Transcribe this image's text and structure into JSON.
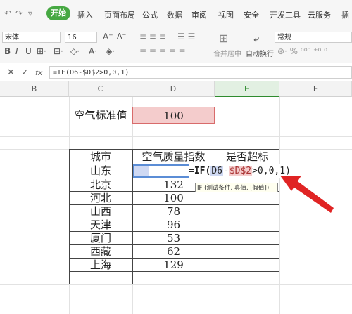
{
  "ribbon": {
    "tabs": [
      "开始",
      "插入",
      "页面布局",
      "公式",
      "数据",
      "审阅",
      "视图",
      "安全",
      "开发工具",
      "云服务",
      "插"
    ],
    "active_tab": "开始"
  },
  "toolbar": {
    "font_name": "宋体",
    "font_size": "16",
    "merge_center": "合并居中",
    "wrap_text": "自动换行",
    "number_format": "常规"
  },
  "formula_bar": {
    "formula": "=IF(D6-$D$2>0,0,1)"
  },
  "columns": [
    "B",
    "C",
    "D",
    "E",
    "F"
  ],
  "sheet": {
    "standard_label": "空气标准值",
    "standard_value": "100",
    "headers": [
      "城市",
      "空气质量指数",
      "是否超标"
    ],
    "rows": [
      {
        "city": "山东",
        "aqi": ""
      },
      {
        "city": "北京",
        "aqi": "132"
      },
      {
        "city": "河北",
        "aqi": "100"
      },
      {
        "city": "山西",
        "aqi": "78"
      },
      {
        "city": "天津",
        "aqi": "96"
      },
      {
        "city": "厦门",
        "aqi": "53"
      },
      {
        "city": "西藏",
        "aqi": "62"
      },
      {
        "city": "上海",
        "aqi": "129"
      }
    ],
    "editing": {
      "prefix": "=IF(",
      "ref1": "D6",
      "minus": "-",
      "ref2": "$D$2",
      "suffix": ">0,0,1)"
    },
    "tooltip": "IF (测试条件, 真值, [假值])"
  },
  "colors": {
    "accent": "#46a842",
    "arrow": "#e02424",
    "ref_blue": "#cfd9f3",
    "ref_red": "#f4cccc"
  }
}
